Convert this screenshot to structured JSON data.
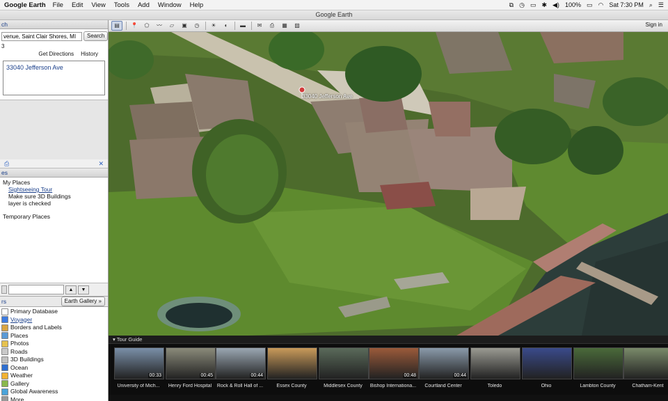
{
  "menubar": {
    "app": "Google Earth",
    "menus": [
      "File",
      "Edit",
      "View",
      "Tools",
      "Add",
      "Window",
      "Help"
    ],
    "battery": "100%",
    "clock": "Sat 7:30 PM"
  },
  "window": {
    "title": "Google Earth"
  },
  "search": {
    "panel_title": "ch",
    "query": "venue, Saint Clair Shores, MI",
    "search_button": "Search",
    "line_marker": "3",
    "get_directions": "Get Directions",
    "history": "History",
    "result": "33040 Jefferson Ave"
  },
  "places": {
    "panel_title": "es",
    "my_places": "My Places",
    "sightseeing": "Sightseeing Tour",
    "note_line1": "Make sure 3D Buildings",
    "note_line2": "layer is checked",
    "temporary": "Temporary Places"
  },
  "layers": {
    "panel_title": "rs",
    "gallery_button": "Earth Gallery",
    "items": [
      {
        "label": "Primary Database",
        "icon": "database-icon",
        "color": "#ffffff"
      },
      {
        "label": "Voyager",
        "icon": "voyager-icon",
        "color": "#3d7be0"
      },
      {
        "label": "Borders and Labels",
        "icon": "borders-icon",
        "color": "#d9a441"
      },
      {
        "label": "Places",
        "icon": "places-icon",
        "color": "#5a9ad6"
      },
      {
        "label": "Photos",
        "icon": "photos-icon",
        "color": "#e5c14e"
      },
      {
        "label": "Roads",
        "icon": "roads-icon",
        "color": "#c9c9c9"
      },
      {
        "label": "3D Buildings",
        "icon": "buildings-icon",
        "color": "#c0c0c0"
      },
      {
        "label": "Ocean",
        "icon": "ocean-icon",
        "color": "#2f6fcf"
      },
      {
        "label": "Weather",
        "icon": "weather-icon",
        "color": "#f2b233"
      },
      {
        "label": "Gallery",
        "icon": "gallery-icon",
        "color": "#8ab84c"
      },
      {
        "label": "Global Awareness",
        "icon": "globe-icon",
        "color": "#4aa3d9"
      },
      {
        "label": "More",
        "icon": "more-icon",
        "color": "#999999"
      }
    ]
  },
  "toolbar": {
    "signin": "Sign in"
  },
  "map": {
    "placemark_label": "33040 Jefferson Ave"
  },
  "tour": {
    "heading": "Tour Guide",
    "items": [
      {
        "title": "University of Mich...",
        "duration": "00:33",
        "color": "#7a8fa8"
      },
      {
        "title": "Henry Ford Hospital",
        "duration": "00:45",
        "color": "#8a8a7a"
      },
      {
        "title": "Rock & Roll Hall of ...",
        "duration": "00:44",
        "color": "#9aa6b2"
      },
      {
        "title": "Essex County",
        "duration": "",
        "color": "#c99a5a"
      },
      {
        "title": "Middlesex County",
        "duration": "",
        "color": "#5a6a5a"
      },
      {
        "title": "Bishop Internationa...",
        "duration": "00:48",
        "color": "#9a5a3a"
      },
      {
        "title": "Courtland Center",
        "duration": "00:44",
        "color": "#8a9aaa"
      },
      {
        "title": "Toledo",
        "duration": "",
        "color": "#9a9a92"
      },
      {
        "title": "Ohio",
        "duration": "",
        "color": "#3a4a8a"
      },
      {
        "title": "Lambton County",
        "duration": "",
        "color": "#4a6a3a"
      },
      {
        "title": "Chatham-Kent",
        "duration": "",
        "color": "#7a8a6a"
      }
    ]
  }
}
